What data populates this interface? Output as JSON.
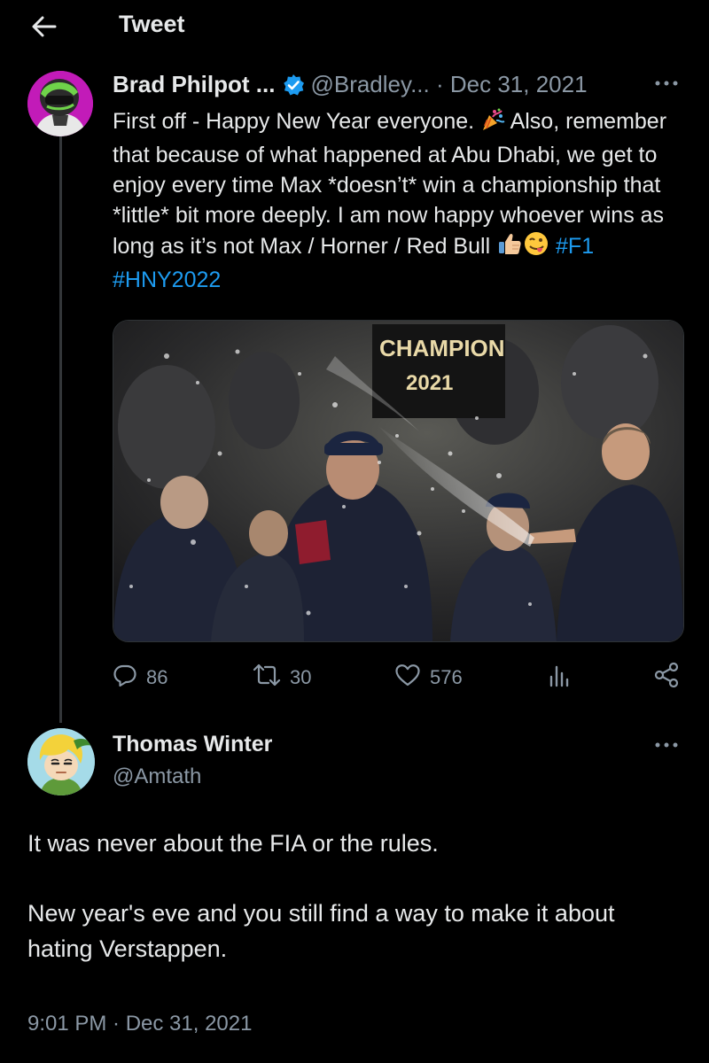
{
  "header": {
    "title": "Tweet"
  },
  "original_tweet": {
    "author_name": "Brad Philpot ...",
    "handle": "@Bradley...",
    "separator": "·",
    "date": "Dec 31, 2021",
    "text_parts": {
      "p1": "First off - Happy New Year everyone. ",
      "p2": " Also, remember that because of what happened at Abu Dhabi, we get to enjoy every time Max *doesn’t* win a championship that *little* bit more deeply. I am now happy whoever wins as long as it’s not Max / Horner / Red Bull ",
      "hashtag1": "#F1",
      "hashtag2": "#HNY2022"
    },
    "image": {
      "banner_line1": "CHAMPION",
      "banner_line2": "2021"
    },
    "stats": {
      "replies": "86",
      "retweets": "30",
      "likes": "576"
    }
  },
  "reply": {
    "author_name": "Thomas Winter",
    "handle": "@Amtath",
    "paragraphs": [
      "It was never about the FIA or the rules.",
      "New year's eve and you still find a way to make it about hating Verstappen."
    ],
    "timestamp": "9:01 PM · Dec 31, 2021"
  },
  "icons": {
    "back": "arrow-left-icon",
    "verified": "verified-badge-icon",
    "more": "more-horizontal-icon",
    "reply": "reply-icon",
    "retweet": "retweet-icon",
    "like": "heart-icon",
    "views": "analytics-icon",
    "share": "share-icon"
  },
  "colors": {
    "background": "#000000",
    "text": "#e7e9ea",
    "secondary": "#8b98a5",
    "link": "#1d9bf0",
    "verified": "#1d9bf0"
  }
}
